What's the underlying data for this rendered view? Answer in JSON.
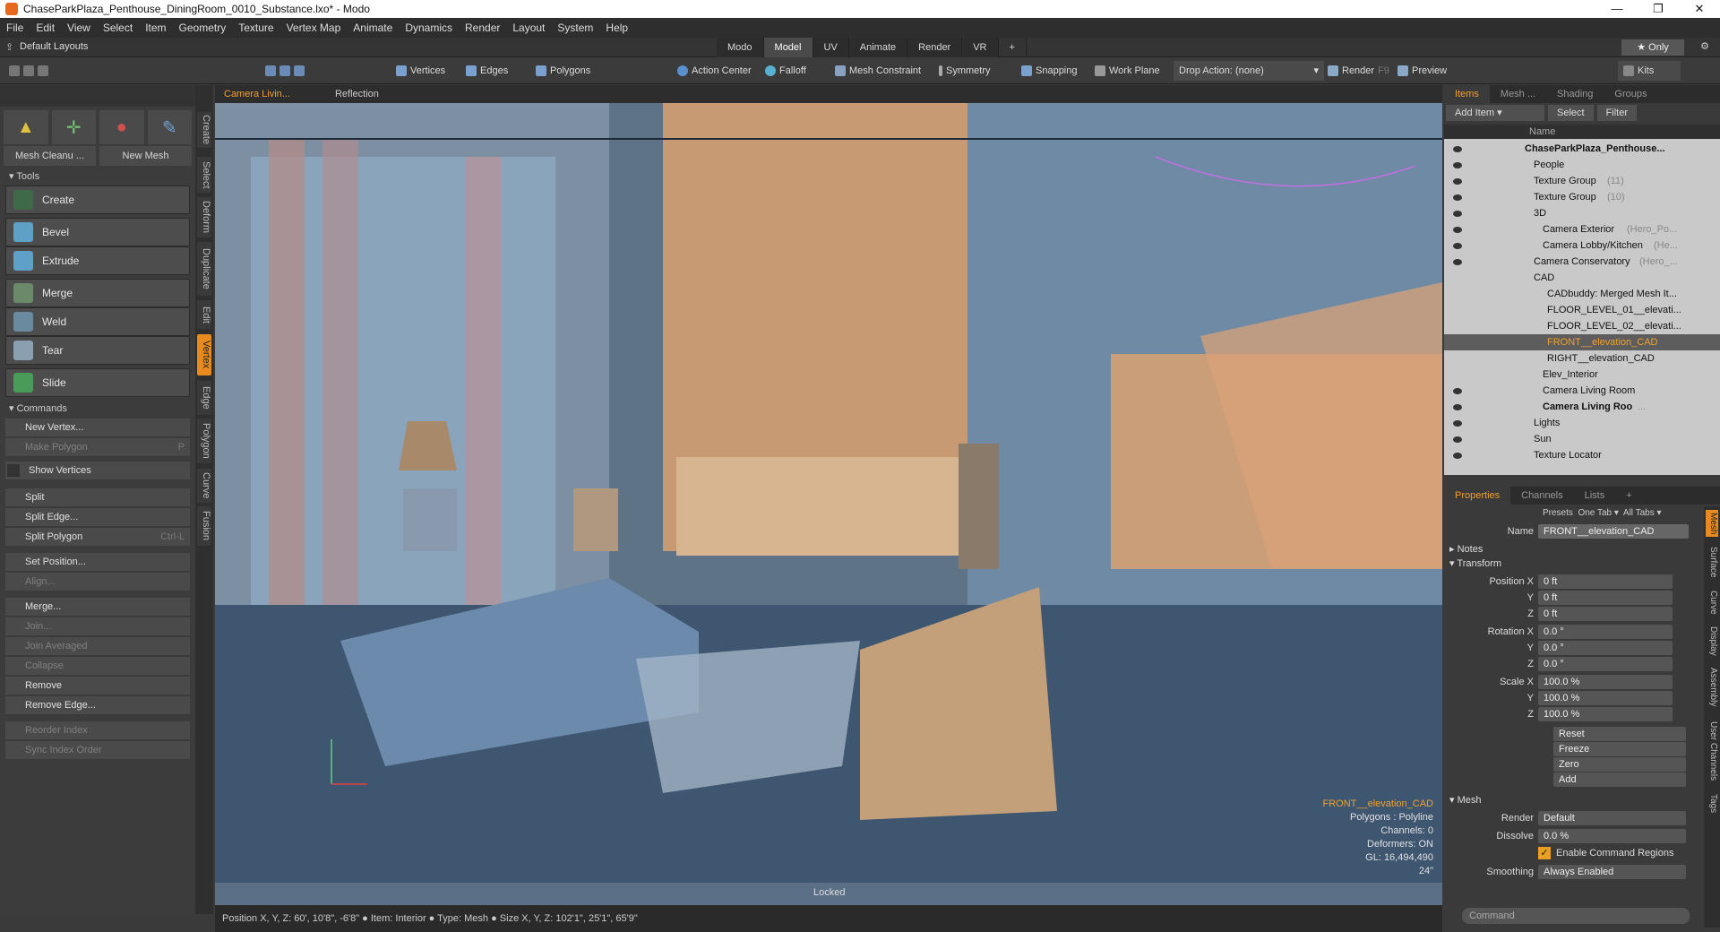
{
  "window": {
    "title": "ChaseParkPlaza_Penthouse_DiningRoom_0010_Substance.lxo* - Modo",
    "controls": [
      "—",
      "❐",
      "✕"
    ]
  },
  "menu": [
    "File",
    "Edit",
    "View",
    "Select",
    "Item",
    "Geometry",
    "Texture",
    "Vertex Map",
    "Animate",
    "Dynamics",
    "Render",
    "Layout",
    "System",
    "Help"
  ],
  "layout": {
    "label": "Default Layouts",
    "tabs": [
      "Modo",
      "Model",
      "UV",
      "Animate",
      "Render",
      "VR",
      "+"
    ],
    "active_tab": "Model",
    "only_label": "Only"
  },
  "toolbar": {
    "vertices": "Vertices",
    "edges": "Edges",
    "polygons": "Polygons",
    "action_center": "Action Center",
    "falloff": "Falloff",
    "mesh_constraint": "Mesh Constraint",
    "symmetry": "Symmetry",
    "snapping": "Snapping",
    "work_plane": "Work Plane",
    "drop_action": "Drop Action: (none)",
    "render": "Render",
    "render_key": "F9",
    "preview": "Preview",
    "kits": "Kits"
  },
  "left": {
    "mesh_cleanup": "Mesh Cleanu ...",
    "new_mesh": "New Mesh",
    "tools_header": "Tools",
    "tools": {
      "create": "Create",
      "bevel": "Bevel",
      "extrude": "Extrude",
      "merge": "Merge",
      "weld": "Weld",
      "tear": "Tear",
      "slide": "Slide"
    },
    "commands_header": "Commands",
    "commands": {
      "new_vertex": "New Vertex...",
      "make_polygon": "Make Polygon",
      "make_polygon_key": "P",
      "show_vertices": "Show Vertices",
      "split": "Split",
      "split_edge": "Split Edge...",
      "split_polygon": "Split Polygon",
      "split_polygon_key": "Ctrl-L",
      "set_position": "Set Position...",
      "align": "Align...",
      "merge": "Merge...",
      "join": "Join...",
      "join_averaged": "Join Averaged",
      "collapse": "Collapse",
      "remove": "Remove",
      "remove_edge": "Remove Edge...",
      "reorder_index": "Reorder Index",
      "sync_index_order": "Sync Index Order"
    },
    "vtabs": [
      "Create",
      "Select",
      "Deform",
      "Duplicate",
      "Edit",
      "Vertex",
      "Edge",
      "Polygon",
      "Curve",
      "Fusion"
    ]
  },
  "viewport": {
    "camera": "Camera Livin...",
    "shading": "Reflection",
    "info": {
      "selection": "FRONT__elevation_CAD",
      "polygons": "Polygons : Polyline",
      "channels": "Channels: 0",
      "deformers": "Deformers: ON",
      "gl": "GL: 16,494,490",
      "focal": "24\""
    },
    "locked": "Locked"
  },
  "status": "Position X, Y, Z:  60', 10'8\", -6'8\"  ● Item: Interior ● Type: Mesh ● Size X, Y, Z:  102'1\", 25'1\", 65'9\"",
  "right": {
    "top_tabs": [
      "Items",
      "Mesh ...",
      "Shading",
      "Groups"
    ],
    "add_item": "Add Item",
    "select": "Select",
    "filter": "Filter",
    "tree_header": "Name",
    "tree": [
      {
        "label": "ChaseParkPlaza_Penthouse...",
        "suffix": "",
        "indent": 90,
        "eye": true
      },
      {
        "label": "People",
        "suffix": "",
        "indent": 100,
        "eye": true
      },
      {
        "label": "Texture Group",
        "suffix": "(11)",
        "indent": 100,
        "eye": true
      },
      {
        "label": "Texture Group",
        "suffix": "(10)",
        "indent": 100,
        "eye": true
      },
      {
        "label": "3D",
        "suffix": "",
        "indent": 100,
        "eye": true
      },
      {
        "label": "Camera Exterior",
        "suffix": "(Hero_Po...",
        "indent": 110,
        "eye": true
      },
      {
        "label": "Camera Lobby/Kitchen",
        "suffix": "(He...",
        "indent": 110,
        "eye": true
      },
      {
        "label": "Camera Conservatory",
        "suffix": "(Hero_...",
        "indent": 100,
        "eye": true
      },
      {
        "label": "CAD",
        "suffix": "",
        "indent": 100,
        "eye": false
      },
      {
        "label": "CADbuddy: Merged Mesh It...",
        "suffix": "",
        "indent": 115,
        "eye": false
      },
      {
        "label": "FLOOR_LEVEL_01__elevati...",
        "suffix": "",
        "indent": 115,
        "eye": false
      },
      {
        "label": "FLOOR_LEVEL_02__elevati...",
        "suffix": "",
        "indent": 115,
        "eye": false
      },
      {
        "label": "FRONT__elevation_CAD",
        "suffix": "",
        "indent": 115,
        "eye": false,
        "selected": true
      },
      {
        "label": "RIGHT__elevation_CAD",
        "suffix": "",
        "indent": 115,
        "eye": false
      },
      {
        "label": "Elev_Interior",
        "suffix": "",
        "indent": 110,
        "eye": false
      },
      {
        "label": "Camera Living Room",
        "suffix": "",
        "indent": 110,
        "eye": true
      },
      {
        "label": "Camera Living Roo",
        "suffix": "...",
        "indent": 110,
        "eye": true
      },
      {
        "label": "Lights",
        "suffix": "",
        "indent": 100,
        "eye": true
      },
      {
        "label": "Sun",
        "suffix": "",
        "indent": 100,
        "eye": true
      },
      {
        "label": "Texture Locator",
        "suffix": "",
        "indent": 100,
        "eye": true
      }
    ],
    "prop_tabs": [
      "Properties",
      "Channels",
      "Lists",
      "+"
    ],
    "presets": "Presets",
    "one_tab": "One Tab",
    "all_tabs": "All Tabs",
    "name_label": "Name",
    "name_value": "FRONT__elevation_CAD",
    "notes": "Notes",
    "transform": "Transform",
    "position_label": "Position X",
    "pos": [
      "0 ft",
      "0 ft",
      "0 ft"
    ],
    "rotation_label": "Rotation X",
    "rot": [
      "0.0 °",
      "0.0 °",
      "0.0 °"
    ],
    "scale_label": "Scale X",
    "scl": [
      "100.0 %",
      "100.0 %",
      "100.0 %"
    ],
    "y": "Y",
    "z": "Z",
    "actions": [
      "Reset",
      "Freeze",
      "Zero",
      "Add"
    ],
    "mesh": "Mesh",
    "render_label": "Render",
    "render_value": "Default",
    "dissolve_label": "Dissolve",
    "dissolve_value": "0.0 %",
    "enable_cmd": "Enable Command Regions",
    "smoothing_label": "Smoothing",
    "smoothing_value": "Always Enabled",
    "side_tabs": [
      "Mesh",
      "Surface",
      "Curve",
      "Display",
      "Assembly",
      "User Channels",
      "Tags"
    ],
    "command": "Command"
  }
}
